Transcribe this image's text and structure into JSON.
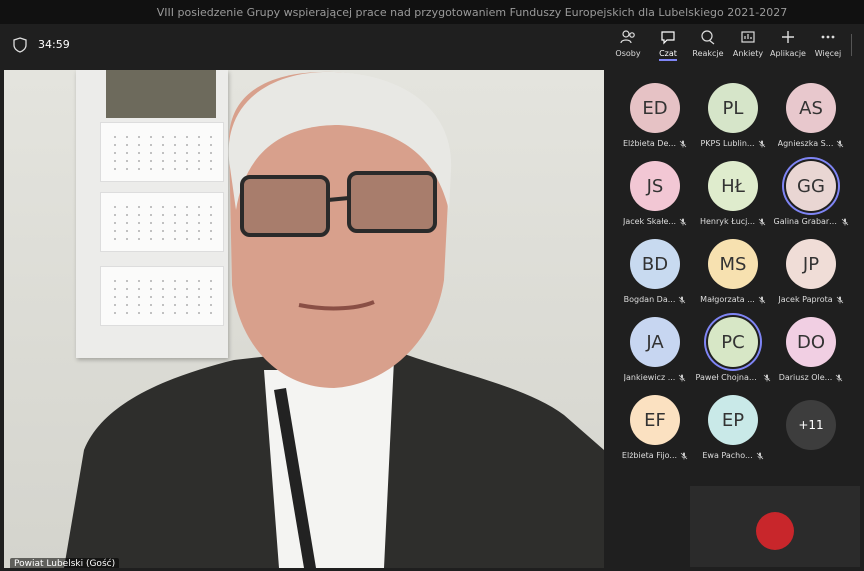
{
  "window": {
    "title": "VIII posiedzenie Grupy wspierającej prace nad przygotowaniem Funduszy Europejskich dla Lubelskiego 2021-2027"
  },
  "toolbar": {
    "timer": "34:59",
    "tools": [
      {
        "label": "Osoby",
        "icon": "people-icon"
      },
      {
        "label": "Czat",
        "icon": "chat-icon"
      },
      {
        "label": "Reakcje",
        "icon": "reactions-icon"
      },
      {
        "label": "Ankiety",
        "icon": "polls-icon"
      },
      {
        "label": "Aplikacje",
        "icon": "plus-icon"
      },
      {
        "label": "Więcej",
        "icon": "more-icon"
      }
    ]
  },
  "main_video": {
    "name": "Powiat Lubelski (Gość)"
  },
  "participants": [
    {
      "initials": "ED",
      "name": "Elżbieta De...",
      "color": "#e6c2c5"
    },
    {
      "initials": "PL",
      "name": "PKPS Lublin...",
      "color": "#d6e5c9"
    },
    {
      "initials": "AS",
      "name": "Agnieszka S...",
      "color": "#e8c8cd"
    },
    {
      "initials": "JS",
      "name": "Jacek Skałe...",
      "color": "#f2c7d4"
    },
    {
      "initials": "HŁ",
      "name": "Henryk Łucj...",
      "color": "#dfeccd"
    },
    {
      "initials": "GG",
      "name": "Galina Grabarcz...",
      "color": "#e9d6d3"
    },
    {
      "initials": "BD",
      "name": "Bogdan Da...",
      "color": "#c8daf0"
    },
    {
      "initials": "MS",
      "name": "Małgorzata ...",
      "color": "#f7e1b0"
    },
    {
      "initials": "JP",
      "name": "Jacek Paprota",
      "color": "#f0ddd7"
    },
    {
      "initials": "JA",
      "name": "Jankiewicz ...",
      "color": "#c7d6f1"
    },
    {
      "initials": "PC",
      "name": "Paweł Chojnack...",
      "color": "#d7e7c6"
    },
    {
      "initials": "DO",
      "name": "Dariusz Ole...",
      "color": "#f1cfe3"
    },
    {
      "initials": "EF",
      "name": "Elżbieta Fijo...",
      "color": "#fbe1c1"
    },
    {
      "initials": "EP",
      "name": "Ewa Pacho...",
      "color": "#c9e9e8"
    }
  ],
  "more_count": "+11",
  "colors": {
    "accent": "#7f85f5",
    "panel_bg": "#1f1f1f"
  }
}
